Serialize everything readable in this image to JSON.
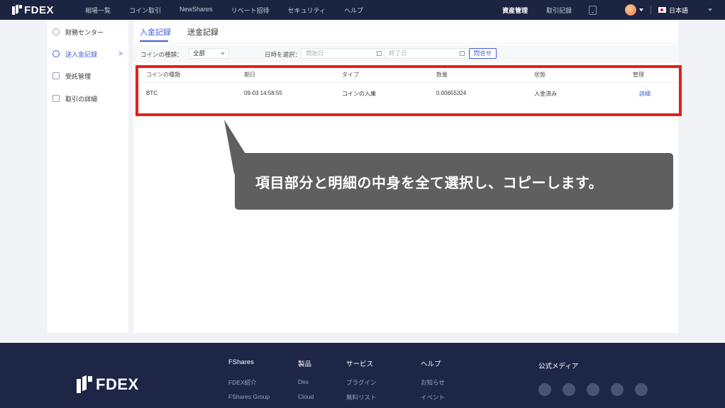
{
  "header": {
    "logo": "FDEX",
    "nav": [
      "相場一覧",
      "コイン取引",
      "NewShares",
      "リベート招待",
      "セキュリティ",
      "ヘルプ"
    ],
    "asset_management": "資産管理",
    "trade_history": "取引記録",
    "language": "日本語"
  },
  "sidebar": {
    "items": [
      {
        "label": "財務センター",
        "icon": "wallet-icon"
      },
      {
        "label": "送入金記録",
        "icon": "transfer-icon",
        "chevron": ">"
      },
      {
        "label": "受託管理",
        "icon": "document-icon"
      },
      {
        "label": "取引の詳細",
        "icon": "list-icon"
      }
    ]
  },
  "tabs": {
    "deposit": "入金記録",
    "withdraw": "送金記録"
  },
  "filters": {
    "coin_type_label": "コインの種類：",
    "coin_type_value": "全部",
    "date_label": "日時を選択：",
    "start_placeholder": "開始日",
    "end_placeholder": "終了日",
    "query_button": "問合せ"
  },
  "table": {
    "headers": [
      "コインの種類",
      "期日",
      "タイプ",
      "数量",
      "状態",
      "管理"
    ],
    "rows": [
      {
        "coin": "BTC",
        "date": "09-03 14:58:55",
        "type": "コインの入庫",
        "amount": "0.00655324",
        "status": "入金済み",
        "action": "詳細"
      }
    ]
  },
  "callout": {
    "text": "項目部分と明細の中身を全て選択し、コピーします。"
  },
  "footer": {
    "logo": "FDEX",
    "columns": [
      {
        "title": "FShares",
        "items": [
          "FDEX紹介",
          "FShares Group"
        ]
      },
      {
        "title": "製品",
        "items": [
          "Dex",
          "Cloud"
        ]
      },
      {
        "title": "サービス",
        "items": [
          "プラグイン",
          "無料リスト"
        ]
      },
      {
        "title": "ヘルプ",
        "items": [
          "お知らせ",
          "イベント"
        ]
      }
    ],
    "social_title": "公式メディア",
    "social_icons": [
      "vk-icon",
      "wechat-icon",
      "telegram-icon",
      "twitter-icon",
      "facebook-icon"
    ]
  },
  "colors": {
    "topbar": "#1b2440",
    "accent": "#3f5bd8",
    "highlight": "#e4211a",
    "callout": "#5f5f5f",
    "footer": "#1e2647"
  }
}
